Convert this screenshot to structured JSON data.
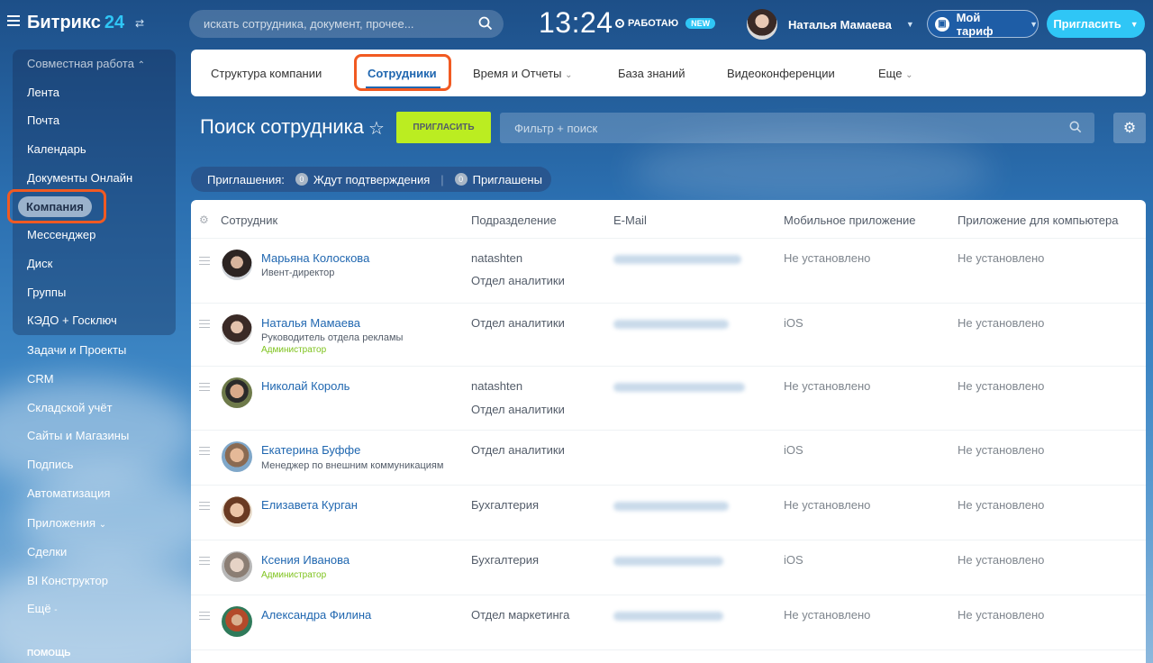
{
  "app": {
    "logo_text": "Битрикс",
    "logo_number": "24",
    "search_placeholder": "искать сотрудника, документ, прочее...",
    "clock": "13:24",
    "work_status": "РАБОТАЮ",
    "new_badge": "NEW",
    "user_name": "Наталья Мамаева",
    "tariff_label": "Мой тариф",
    "invite_label": "Пригласить"
  },
  "sidebar": {
    "group_label": "Совместная работа",
    "items": [
      "Лента",
      "Почта",
      "Календарь",
      "Документы Онлайн",
      "Компания",
      "Мессенджер",
      "Диск",
      "Группы",
      "КЭДО + Госключ",
      "Задачи и Проекты",
      "CRM",
      "Складской учёт",
      "Сайты и Магазины",
      "Подпись",
      "Автоматизация",
      "Приложения",
      "Сделки",
      "BI Конструктор",
      "Ещё"
    ],
    "active_item": "Компания",
    "help": "ПОМОЩЬ"
  },
  "nav": {
    "tabs": [
      "Структура компании",
      "Сотрудники",
      "Время и Отчеты",
      "База знаний",
      "Видеоконференции",
      "Еще"
    ],
    "active_tab": "Сотрудники"
  },
  "toolbar": {
    "title": "Поиск сотрудника",
    "invite_button": "ПРИГЛАСИТЬ",
    "filter_placeholder": "Фильтр + поиск"
  },
  "invites": {
    "label": "Приглашения:",
    "pending_count": "0",
    "pending_label": "Ждут подтверждения",
    "invited_count": "0",
    "invited_label": "Приглашены"
  },
  "table": {
    "columns": [
      "Сотрудник",
      "Подразделение",
      "E-Mail",
      "Мобильное приложение",
      "Приложение для компьютера"
    ],
    "rows": [
      {
        "name": "Марьяна Колоскова",
        "position": "Ивент-директор",
        "admin": "",
        "dept1": "natashten",
        "dept2": "Отдел аналитики",
        "mobile": "Не установлено",
        "desktop": "Не установлено"
      },
      {
        "name": "Наталья Мамаева",
        "position": "Руководитель отдела рекламы",
        "admin": "Администратор",
        "dept1": "Отдел аналитики",
        "dept2": "",
        "mobile": "iOS",
        "desktop": "Не установлено"
      },
      {
        "name": "Николай Король",
        "position": "",
        "admin": "",
        "dept1": "natashten",
        "dept2": "Отдел аналитики",
        "mobile": "Не установлено",
        "desktop": "Не установлено"
      },
      {
        "name": "Екатерина Буффе",
        "position": "Менеджер по внешним коммуникациям",
        "admin": "",
        "dept1": "Отдел аналитики",
        "dept2": "",
        "mobile": "iOS",
        "desktop": "Не установлено"
      },
      {
        "name": "Елизавета Курган",
        "position": "",
        "admin": "",
        "dept1": "Бухгалтерия",
        "dept2": "",
        "mobile": "Не установлено",
        "desktop": "Не установлено"
      },
      {
        "name": "Ксения Иванова",
        "position": "",
        "admin": "Администратор",
        "dept1": "Бухгалтерия",
        "dept2": "",
        "mobile": "iOS",
        "desktop": "Не установлено"
      },
      {
        "name": "Александра Филина",
        "position": "",
        "admin": "",
        "dept1": "Отдел маркетинга",
        "dept2": "",
        "mobile": "Не установлено",
        "desktop": "Не установлено"
      }
    ]
  },
  "colors": {
    "accent": "#2fc6f6",
    "link": "#2067b0",
    "invite_green": "#bbed21",
    "highlight": "#f15a22"
  }
}
